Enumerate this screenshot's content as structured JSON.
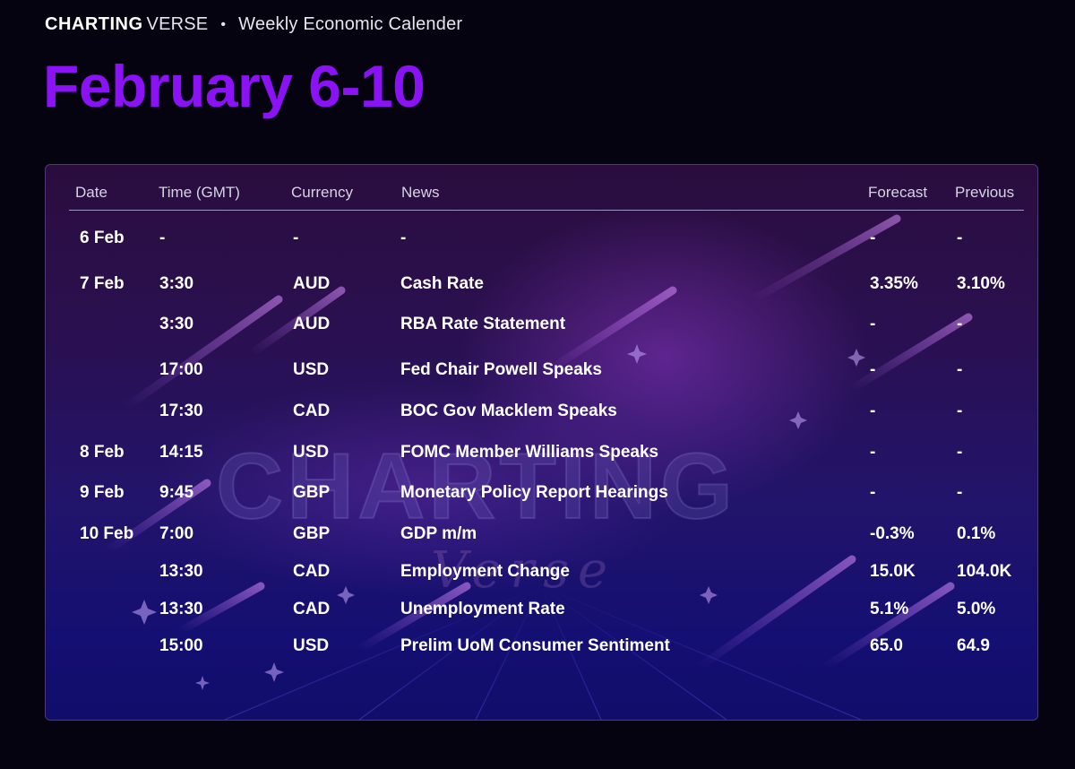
{
  "brand": {
    "name_bold": "CHARTING",
    "name_light": "VERSE",
    "separator": "•",
    "subtitle": "Weekly Economic Calender"
  },
  "headline": "February 6-10",
  "watermark": {
    "main": "CHARTING",
    "sub": "Verse"
  },
  "table": {
    "columns": [
      "Date",
      "Time (GMT)",
      "Currency",
      "News",
      "Forecast",
      "Previous"
    ],
    "rows": [
      {
        "date": "6 Feb",
        "time": "-",
        "currency": "-",
        "news": "-",
        "forecast": "-",
        "previous": "-"
      },
      {
        "date": "7 Feb",
        "time": "3:30",
        "currency": "AUD",
        "news": "Cash Rate",
        "forecast": "3.35%",
        "previous": "3.10%"
      },
      {
        "date": "",
        "time": "3:30",
        "currency": "AUD",
        "news": "RBA Rate Statement",
        "forecast": "-",
        "previous": "-"
      },
      {
        "date": "",
        "time": "17:00",
        "currency": "USD",
        "news": "Fed Chair Powell Speaks",
        "forecast": "-",
        "previous": "-"
      },
      {
        "date": "",
        "time": "17:30",
        "currency": "CAD",
        "news": "BOC Gov Macklem Speaks",
        "forecast": "-",
        "previous": "-"
      },
      {
        "date": "8 Feb",
        "time": "14:15",
        "currency": "USD",
        "news": "FOMC Member Williams Speaks",
        "forecast": "-",
        "previous": "-"
      },
      {
        "date": "9 Feb",
        "time": "9:45",
        "currency": "GBP",
        "news": "Monetary Policy Report Hearings",
        "forecast": "-",
        "previous": "-"
      },
      {
        "date": "10 Feb",
        "time": "7:00",
        "currency": "GBP",
        "news": "GDP m/m",
        "forecast": "-0.3%",
        "previous": "0.1%"
      },
      {
        "date": "",
        "time": "13:30",
        "currency": "CAD",
        "news": "Employment Change",
        "forecast": "15.0K",
        "previous": "104.0K"
      },
      {
        "date": "",
        "time": "13:30",
        "currency": "CAD",
        "news": "Unemployment Rate",
        "forecast": "5.1%",
        "previous": "5.0%"
      },
      {
        "date": "",
        "time": "15:00",
        "currency": "USD",
        "news": "Prelim UoM Consumer Sentiment",
        "forecast": "65.0",
        "previous": "64.9"
      }
    ]
  },
  "colors": {
    "background": "#05030f",
    "headline": "#8b12f5",
    "panel_top": "#2a0d3e",
    "panel_bottom": "#100d6b",
    "text": "#ffffff"
  }
}
